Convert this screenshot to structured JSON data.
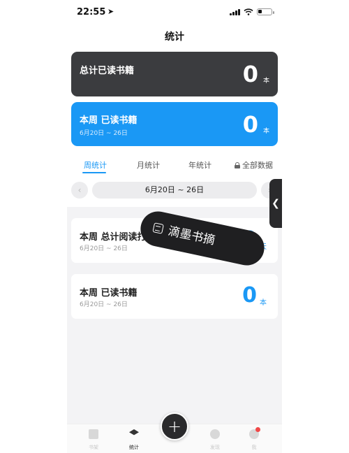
{
  "status_bar": {
    "time": "22:55",
    "location_arrow": "➤"
  },
  "nav": {
    "title": "统计"
  },
  "total_card": {
    "title": "总计已读书籍",
    "count": "0",
    "unit": "本",
    "color": "#3b3c3f"
  },
  "week_card": {
    "title": "本周 已读书籍",
    "date_range": "6月20日 ~ 26日",
    "count": "0",
    "unit": "本",
    "color": "#1a98f5"
  },
  "tabs": [
    {
      "label": "周统计",
      "active": true
    },
    {
      "label": "月统计",
      "active": false
    },
    {
      "label": "年统计",
      "active": false
    },
    {
      "label": "全部数据",
      "icon": "lock-icon",
      "active": false
    }
  ],
  "date_selector": {
    "prev": "‹",
    "label": "6月20日 ~ 26日",
    "next": "›"
  },
  "stats": [
    {
      "title": "本周 总计阅读打卡",
      "date_range": "6月20日 ~ 26日",
      "value": "0",
      "unit": "天"
    },
    {
      "title": "本周 已读书籍",
      "date_range": "6月20日 ~ 26日",
      "value": "0",
      "unit": "本"
    }
  ],
  "watermark": {
    "text": "滴墨书摘"
  },
  "bottom_nav": [
    {
      "label": "书架",
      "icon": "book-icon",
      "active": false
    },
    {
      "label": "统计",
      "icon": "layers-icon",
      "active": true
    },
    {
      "label": "发现",
      "icon": "compass-icon",
      "active": false
    },
    {
      "label": "我",
      "icon": "user-icon",
      "active": false,
      "badge": true
    }
  ],
  "fab": {
    "label": "+"
  },
  "side_handle": {
    "glyph": "❮"
  }
}
